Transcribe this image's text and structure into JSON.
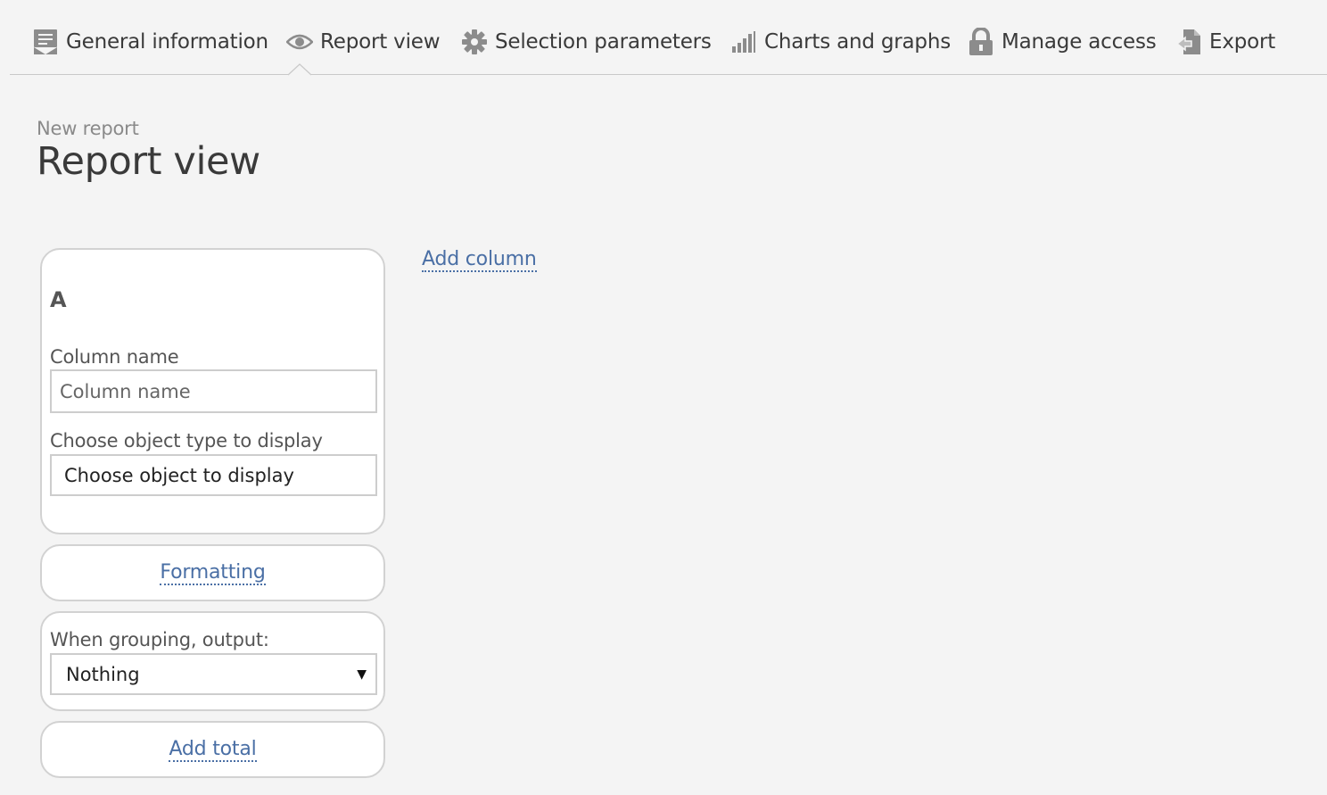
{
  "nav": {
    "items": [
      {
        "label": "General information",
        "icon": "document-icon"
      },
      {
        "label": "Report view",
        "icon": "eye-icon",
        "active": true
      },
      {
        "label": "Selection parameters",
        "icon": "gear-icon"
      },
      {
        "label": "Charts and graphs",
        "icon": "bar-chart-icon"
      },
      {
        "label": "Manage access",
        "icon": "lock-icon"
      },
      {
        "label": "Export",
        "icon": "export-icon"
      }
    ]
  },
  "header": {
    "breadcrumb": "New report",
    "title": "Report view"
  },
  "column": {
    "letter": "A",
    "name_label": "Column name",
    "name_placeholder": "Column name",
    "name_value": "",
    "object_label": "Choose object type to display",
    "object_value": "Choose object to display",
    "formatting_link": "Formatting",
    "grouping_label": "When grouping, output:",
    "grouping_value": "Nothing",
    "add_total_link": "Add total"
  },
  "actions": {
    "add_column": "Add column"
  },
  "colors": {
    "link": "#4a6fa5",
    "icon": "#8c8c8c",
    "background": "#f4f4f4"
  }
}
